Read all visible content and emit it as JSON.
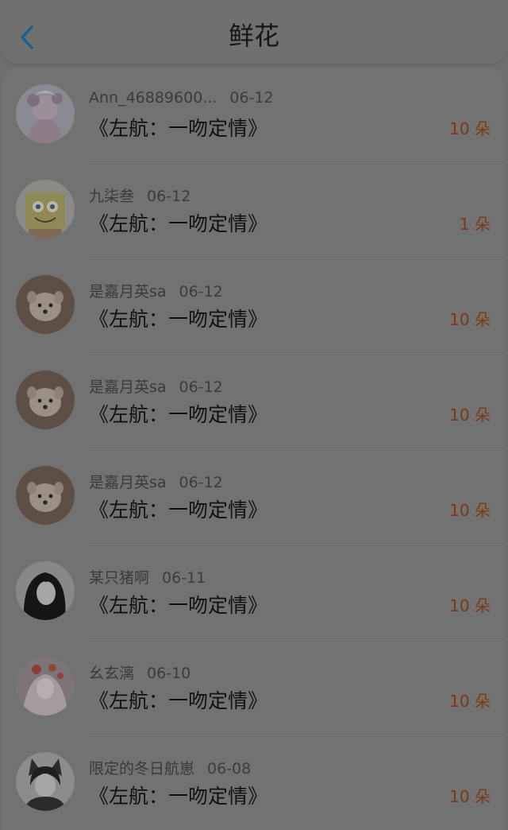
{
  "header": {
    "title": "鲜花",
    "back_icon": "chevron-left-icon",
    "back_color": "#1b5f8f"
  },
  "accent_color": "#7a3a14",
  "items": [
    {
      "user": "Ann_46889600...",
      "date": "06-12",
      "book": "《左航：一吻定情》",
      "amount": "10 朵",
      "avatar": "anime-girl-avatar"
    },
    {
      "user": "九柒叁",
      "date": "06-12",
      "book": "《左航：一吻定情》",
      "amount": "1 朵",
      "avatar": "spongebob-avatar"
    },
    {
      "user": "是嘉月英sa",
      "date": "06-12",
      "book": "《左航：一吻定情》",
      "amount": "10 朵",
      "avatar": "puppy-avatar"
    },
    {
      "user": "是嘉月英sa",
      "date": "06-12",
      "book": "《左航：一吻定情》",
      "amount": "10 朵",
      "avatar": "puppy-avatar"
    },
    {
      "user": "是嘉月英sa",
      "date": "06-12",
      "book": "《左航：一吻定情》",
      "amount": "10 朵",
      "avatar": "puppy-avatar"
    },
    {
      "user": "某只猪啊",
      "date": "06-11",
      "book": "《左航：一吻定情》",
      "amount": "10 朵",
      "avatar": "dark-hair-girl-avatar"
    },
    {
      "user": "幺玄漓",
      "date": "06-10",
      "book": "《左航：一吻定情》",
      "amount": "10 朵",
      "avatar": "anime-flower-girl-avatar"
    },
    {
      "user": "限定的冬日航崽",
      "date": "06-08",
      "book": "《左航：一吻定情》",
      "amount": "10 朵",
      "avatar": "boy-cat-ears-avatar"
    }
  ]
}
